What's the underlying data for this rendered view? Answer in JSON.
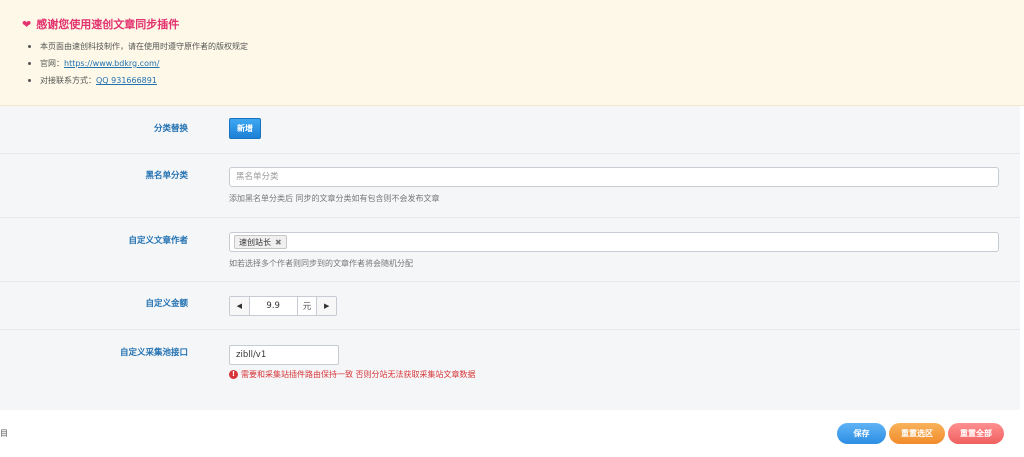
{
  "notice": {
    "title": "感谢您使用速创文章同步插件",
    "items": [
      {
        "text": "本页面由速创科技制作，请在使用时遵守原作者的版权规定",
        "link": ""
      },
      {
        "text": "官网：",
        "link": "https://www.bdkrg.com/"
      },
      {
        "text": "对接联系方式：",
        "link": "QQ 931666891"
      }
    ]
  },
  "form": {
    "category_replace": {
      "label": "分类替换",
      "button": "新增"
    },
    "blacklist": {
      "label": "黑名单分类",
      "placeholder": "黑名单分类",
      "hint": "添加黑名单分类后 同步的文章分类如有包含则不会发布文章"
    },
    "custom_author": {
      "label": "自定义文章作者",
      "tag": "速创站长",
      "hint": "如若选择多个作者则同步到的文章作者将会随机分配"
    },
    "custom_amount": {
      "label": "自定义金额",
      "value": "9.9",
      "unit": "元"
    },
    "custom_api": {
      "label": "自定义采集池接口",
      "value": "zibll/v1",
      "error": "需要和采集站插件路由保持一致 否则分站无法获取采集站文章数据"
    }
  },
  "footer": {
    "left_text": "目",
    "save": "保存",
    "reset_section": "重置选区",
    "reset_all": "重置全部"
  },
  "colors": {
    "accent": "#2271b1",
    "notice_bg": "#fdf8e7",
    "title_pink": "#e2326f",
    "error": "#d63638"
  }
}
